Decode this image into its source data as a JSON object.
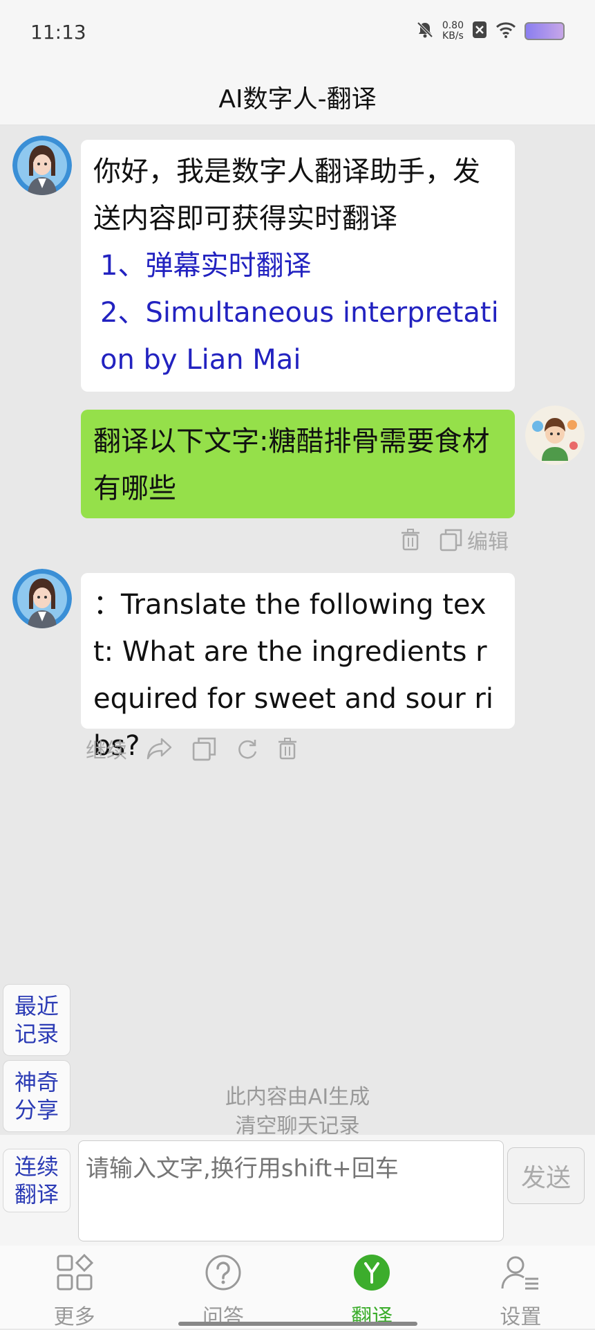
{
  "status_bar": {
    "time": "11:13",
    "net_speed_value": "0.80",
    "net_speed_unit": "KB/s",
    "icons": [
      "bell-muted-icon",
      "sim-x-icon",
      "wifi-icon",
      "battery-icon"
    ]
  },
  "header": {
    "title": "AI数字人-翻译"
  },
  "messages": [
    {
      "role": "bot",
      "text": "你好，我是数字人翻译助手，发送内容即可获得实时翻译",
      "links": [
        "1、弹幕实时翻译",
        "2、Simultaneous interpretation by Lian Mai"
      ]
    },
    {
      "role": "user",
      "text": "翻译以下文字:糖醋排骨需要食材有哪些",
      "actions": {
        "edit_label": "编辑"
      }
    },
    {
      "role": "bot",
      "text": "：Translate the following text: What are the ingredients required for sweet and sour ribs?",
      "actions": {
        "continue_label": "继续"
      }
    }
  ],
  "side_buttons": {
    "recent": "最近记录",
    "share": "神奇分享",
    "continuous": "连续翻译"
  },
  "notice": {
    "ai_generated": "此内容由AI生成",
    "clear_history": "清空聊天记录"
  },
  "input": {
    "placeholder": "请输入文字,换行用shift+回车",
    "send_label": "发送"
  },
  "tabbar": {
    "tabs": [
      {
        "label": "更多",
        "icon": "grid-icon"
      },
      {
        "label": "问答",
        "icon": "question-icon"
      },
      {
        "label": "翻译",
        "icon": "translate-y-icon"
      },
      {
        "label": "设置",
        "icon": "user-settings-icon"
      }
    ],
    "active_index": 2
  },
  "colors": {
    "user_bubble": "#95e04a",
    "link": "#2222c0",
    "active_tab": "#3cad2c",
    "side_button_text": "#2b3bb5"
  }
}
